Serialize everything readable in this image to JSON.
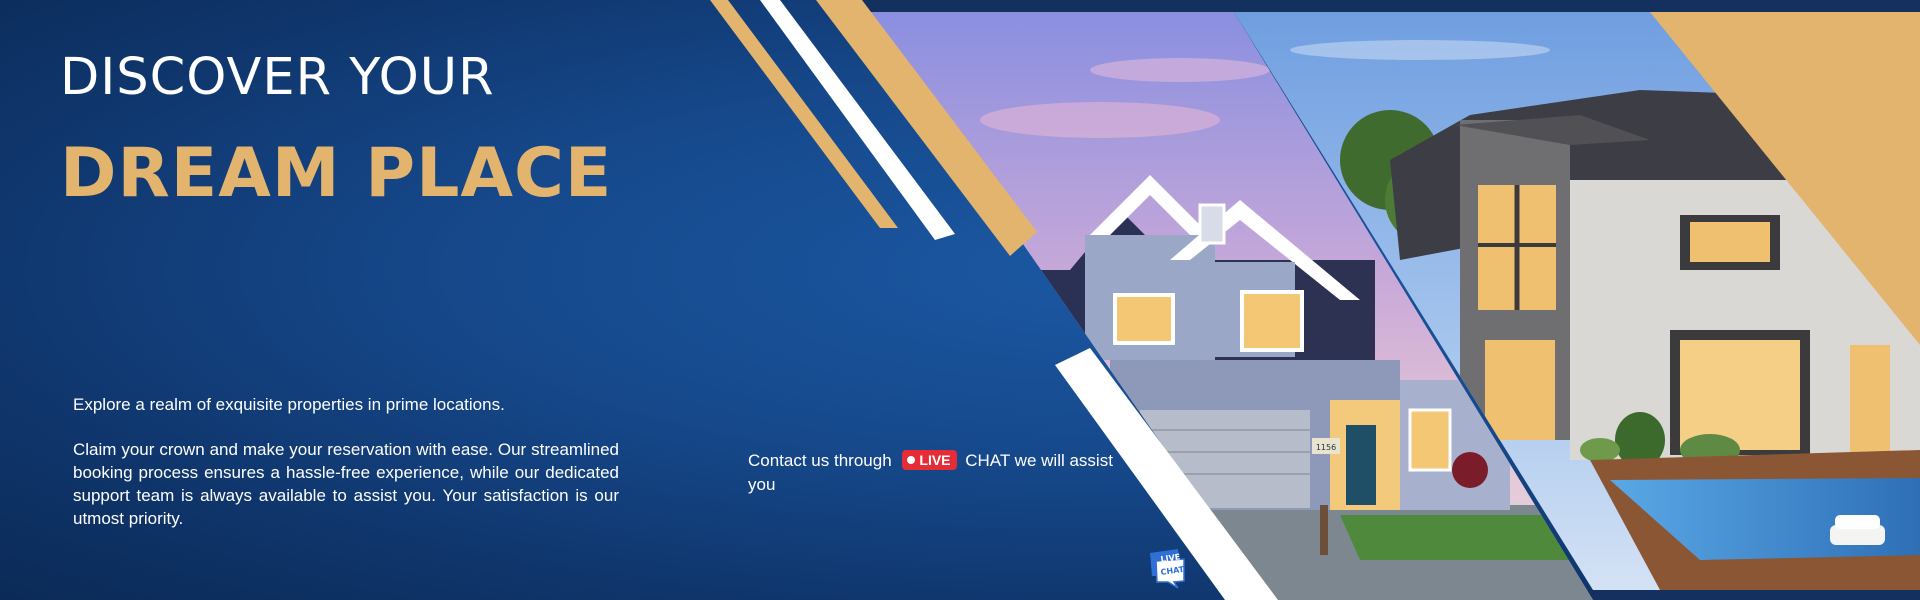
{
  "hero": {
    "headline_line1": "DISCOVER YOUR",
    "headline_line2": "DREAM PLACE",
    "intro": "Explore a realm of exquisite properties in prime locations.",
    "body": "Claim your crown and make your reservation with ease. Our streamlined booking process ensures a hassle-free experience, while our dedicated support team is always available to assist you. Your satisfaction is our utmost priority."
  },
  "contact": {
    "prefix": "Contact us through",
    "live_label": "LIVE",
    "suffix": "CHAT we will assist you"
  },
  "chat_icon": {
    "line1": "LIVE",
    "line2": "CHAT"
  },
  "photos": {
    "left_house_number": "1156"
  },
  "colors": {
    "navy": "#16498c",
    "gold": "#e2b46e",
    "white": "#ffffff",
    "live_red": "#e52d37"
  },
  "icons": [
    "chat-bubble-icon",
    "live-dot-icon"
  ]
}
